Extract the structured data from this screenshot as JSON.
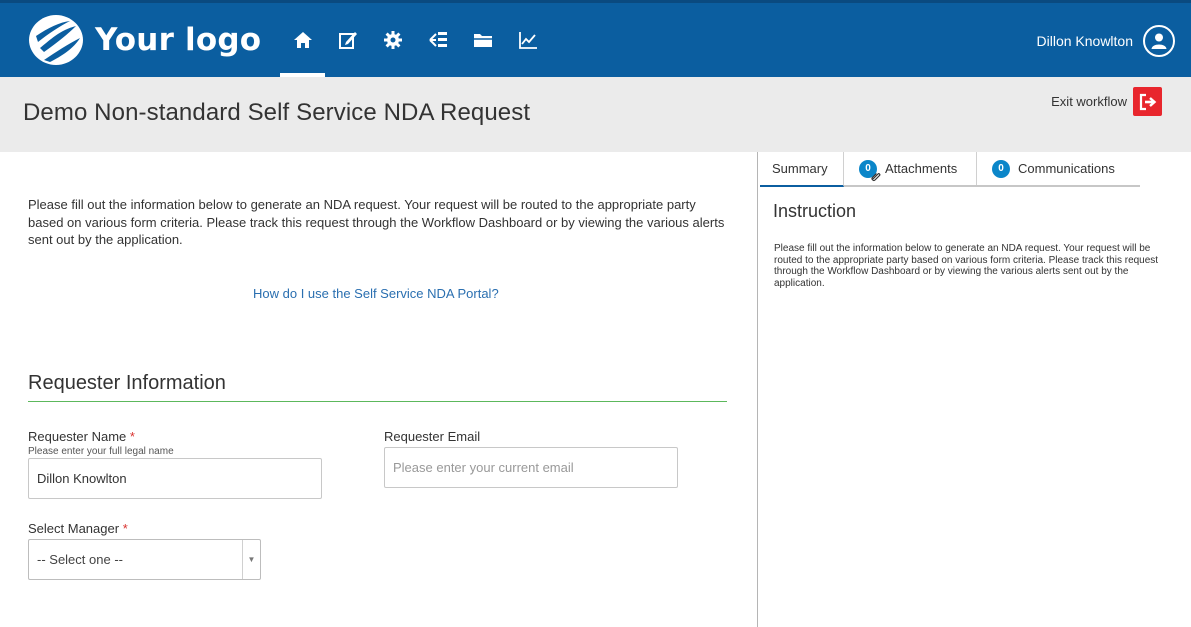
{
  "header": {
    "logo_text": "Your logo",
    "nav_items": [
      "home",
      "edit",
      "settings",
      "workflow",
      "folder",
      "analytics"
    ],
    "active_nav": "home",
    "user_name": "Dillon Knowlton",
    "brand_color": "#0b5ea0"
  },
  "titlebar": {
    "title": "Demo Non-standard Self Service NDA Request",
    "exit_label": "Exit workflow",
    "exit_color": "#e8262d"
  },
  "form": {
    "intro": "Please fill out the information below to generate an NDA request. Your request will be routed to the appropriate party based on various form criteria. Please track this request through the Workflow Dashboard or by viewing the various alerts sent out by the application.",
    "help_link": "How do I use the Self Service NDA Portal?",
    "section_title": "Requester Information",
    "requester_name": {
      "label": "Requester Name",
      "required_mark": "*",
      "hint": "Please enter your full legal name",
      "value": "Dillon Knowlton"
    },
    "requester_email": {
      "label": "Requester Email",
      "placeholder": "Please enter your current email"
    },
    "manager": {
      "label": "Select Manager",
      "required_mark": "*",
      "selected": "-- Select one --"
    }
  },
  "panel": {
    "tabs": [
      {
        "label": "Summary",
        "active": true
      },
      {
        "label": "Attachments",
        "badge": "0"
      },
      {
        "label": "Communications",
        "badge": "0"
      }
    ],
    "title": "Instruction",
    "text": "Please fill out the information below to generate an NDA request. Your request will be routed to the appropriate party based on various form criteria. Please track this request through the Workflow Dashboard or by viewing the various alerts sent out by the application."
  }
}
